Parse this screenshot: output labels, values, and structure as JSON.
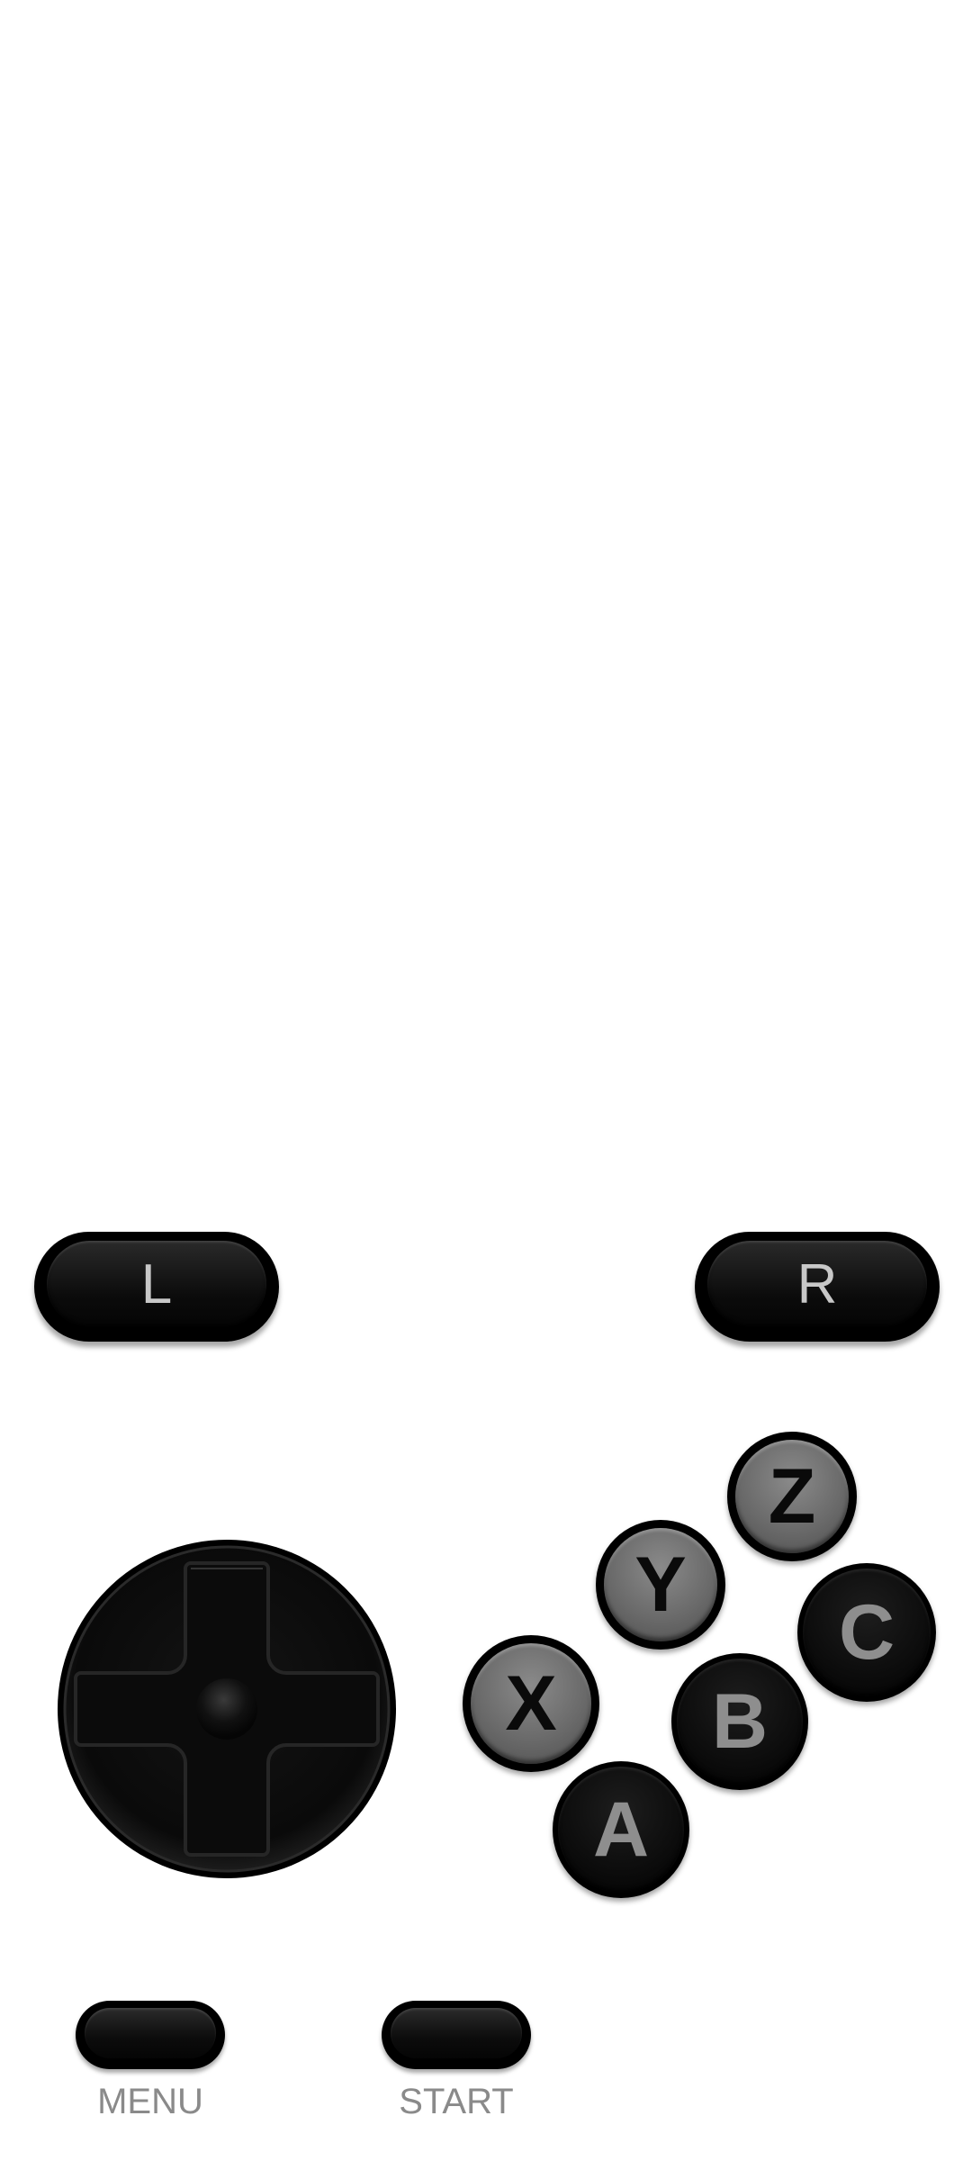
{
  "controller": {
    "shoulder": {
      "left_label": "L",
      "right_label": "R"
    },
    "face_buttons": {
      "z": "Z",
      "y": "Y",
      "c": "C",
      "x": "X",
      "b": "B",
      "a": "A"
    },
    "system": {
      "menu_label": "MENU",
      "start_label": "START"
    },
    "icons": {
      "dpad": "dpad-icon"
    },
    "colors": {
      "button_body": "#000000",
      "grey_button_face": "#6a6a6a",
      "dark_button_letter": "#8e8e8e",
      "label_text": "#8a8a8a",
      "background": "#ffffff"
    }
  }
}
